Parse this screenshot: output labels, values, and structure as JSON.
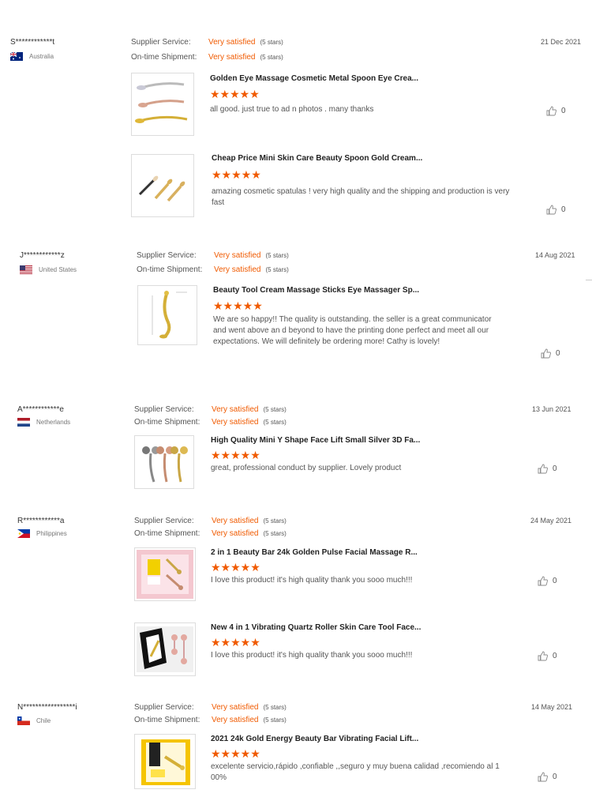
{
  "labels": {
    "supplier_service": "Supplier Service:",
    "ontime_shipment": "On-time Shipment:"
  },
  "reviews": [
    {
      "user": "S************t",
      "country": "Australia",
      "date": "21 Dec 2021",
      "supplier_value": "Very satisfied",
      "supplier_note": "(5 stars)",
      "shipment_value": "Very satisfied",
      "shipment_note": "(5 stars)",
      "items": [
        {
          "title": "Golden Eye Massage Cosmetic Metal Spoon Eye Crea...",
          "stars": "★★★★★",
          "comment": "all good. just true to ad n photos . many thanks",
          "likes": "0"
        },
        {
          "title": "Cheap Price Mini Skin Care Beauty Spoon Gold Cream...",
          "stars": "★★★★★",
          "comment": "amazing cosmetic spatulas ! very high quality and the shipping and production is very fast",
          "likes": "0"
        }
      ]
    },
    {
      "user": "J************z",
      "country": "United States",
      "date": "14 Aug 2021",
      "supplier_value": "Very satisfied",
      "supplier_note": "(5 stars)",
      "shipment_value": "Very satisfied",
      "shipment_note": "(5 stars)",
      "items": [
        {
          "title": "Beauty Tool Cream Massage Sticks Eye Massager Sp...",
          "stars": "★★★★★",
          "comment": "We are so happy!! The quality is outstanding. the seller is a great communicator and went above an d beyond to have the printing done perfect and meet all our expectations. We will definitely be ordering more! Cathy is lovely!",
          "likes": "0"
        }
      ]
    },
    {
      "user": "A************e",
      "country": "Netherlands",
      "date": "13 Jun 2021",
      "supplier_value": "Very satisfied",
      "supplier_note": "(5 stars)",
      "shipment_value": "Very satisfied",
      "shipment_note": "(5 stars)",
      "items": [
        {
          "title": "High Quality Mini Y Shape Face Lift Small Silver 3D Fa...",
          "stars": "★★★★★",
          "comment": "great, professional conduct by supplier. Lovely product",
          "likes": "0"
        }
      ]
    },
    {
      "user": "R************a",
      "country": "Philippines",
      "date": "24 May 2021",
      "supplier_value": "Very satisfied",
      "supplier_note": "(5 stars)",
      "shipment_value": "Very satisfied",
      "shipment_note": "(5 stars)",
      "items": [
        {
          "title": "2 in 1 Beauty Bar 24k Golden Pulse Facial Massage R...",
          "stars": "★★★★★",
          "comment": "I love this product! it's high quality thank you sooo much!!!",
          "likes": "0"
        },
        {
          "title": "New 4 in 1 Vibrating Quartz Roller Skin Care Tool Face...",
          "stars": "★★★★★",
          "comment": "I love this product! it's high quality thank you sooo much!!!",
          "likes": "0"
        }
      ]
    },
    {
      "user": "N*****************i",
      "country": "Chile",
      "date": "14 May 2021",
      "supplier_value": "Very satisfied",
      "supplier_note": "(5 stars)",
      "shipment_value": "Very satisfied",
      "shipment_note": "(5 stars)",
      "items": [
        {
          "title": "2021 24k Gold Energy Beauty Bar Vibrating Facial Lift...",
          "stars": "★★★★★",
          "comment": "excelente servicio,rápido ,confiable ,,seguro y muy buena calidad ,recomiendo al 1 00%",
          "likes": "0"
        }
      ]
    }
  ],
  "colors": {
    "accent": "#f05a00"
  }
}
